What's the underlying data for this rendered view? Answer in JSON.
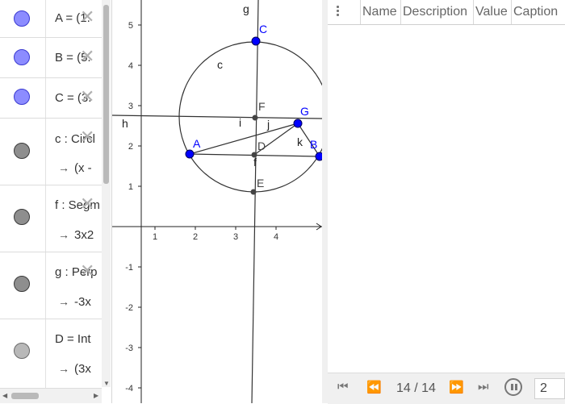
{
  "algebra": {
    "rows": [
      {
        "definition": "A = (1.",
        "value": ""
      },
      {
        "definition": "B = (5.",
        "value": ""
      },
      {
        "definition": "C = (3.",
        "value": ""
      },
      {
        "definition": "c : Circl",
        "value": "(x -"
      },
      {
        "definition": "f : Segm",
        "value": "3x2"
      },
      {
        "definition": "g : Perp",
        "value": "-3x"
      },
      {
        "definition": "D = Int",
        "value": "(3x"
      }
    ],
    "delete_glyph": "✕",
    "arrow_glyph": "→"
  },
  "graphics": {
    "x_ticks": [
      "1",
      "2",
      "3",
      "4"
    ],
    "y_ticks": [
      "5",
      "4",
      "3",
      "2",
      "1",
      "-1",
      "-2",
      "-3",
      "-4"
    ],
    "labels": {
      "A": "A",
      "B": "B",
      "C": "C",
      "D": "D",
      "E": "E",
      "F": "F",
      "G": "G",
      "c": "c",
      "f": "f",
      "g": "g",
      "h": "h",
      "i": "i",
      "j": "j",
      "k": "k"
    },
    "point_color": "#0000ff",
    "aux_point_color": "#444444"
  },
  "table": {
    "columns": [
      "Name",
      "Description",
      "Value",
      "Caption"
    ]
  },
  "player": {
    "step": "14 / 14",
    "speed": "2",
    "first_icon": "skip-to-start-icon",
    "prev_icon": "rewind-icon",
    "next_icon": "fast-forward-icon",
    "last_icon": "skip-to-end-icon",
    "pause_icon": "pause-icon"
  }
}
